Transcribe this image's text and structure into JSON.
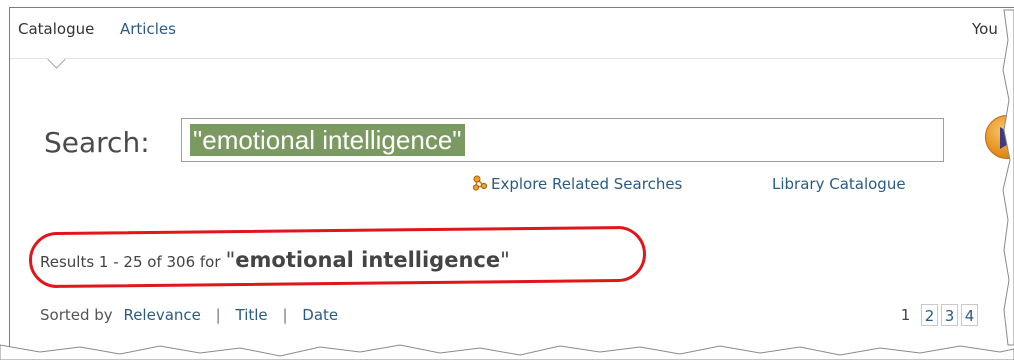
{
  "tabs": {
    "catalogue_label": "Catalogue",
    "articles_label": "Articles",
    "right_label": "You"
  },
  "search": {
    "label": "Search:",
    "value": "\"emotional intelligence\"",
    "go_icon": "play-arrow-icon"
  },
  "links": {
    "explore": "Explore Related Searches",
    "explore_icon": "related-searches-icon",
    "library": "Library Catalogue"
  },
  "results": {
    "prefix": "Results 1 - 25 of 306 for",
    "query_open_quote": "\"",
    "query_text": "emotional intelligence",
    "query_close_quote": "\"",
    "highlight_color": "#e0161a"
  },
  "sort": {
    "label": "Sorted by",
    "options": [
      "Relevance",
      "Title",
      "Date"
    ],
    "separator": "|"
  },
  "pagination": {
    "pages": [
      "1",
      "2",
      "3",
      "4"
    ],
    "current": "1"
  },
  "colors": {
    "link": "#2a5b85",
    "search_highlight": "#7a9a62",
    "go_button": "#e99322"
  }
}
